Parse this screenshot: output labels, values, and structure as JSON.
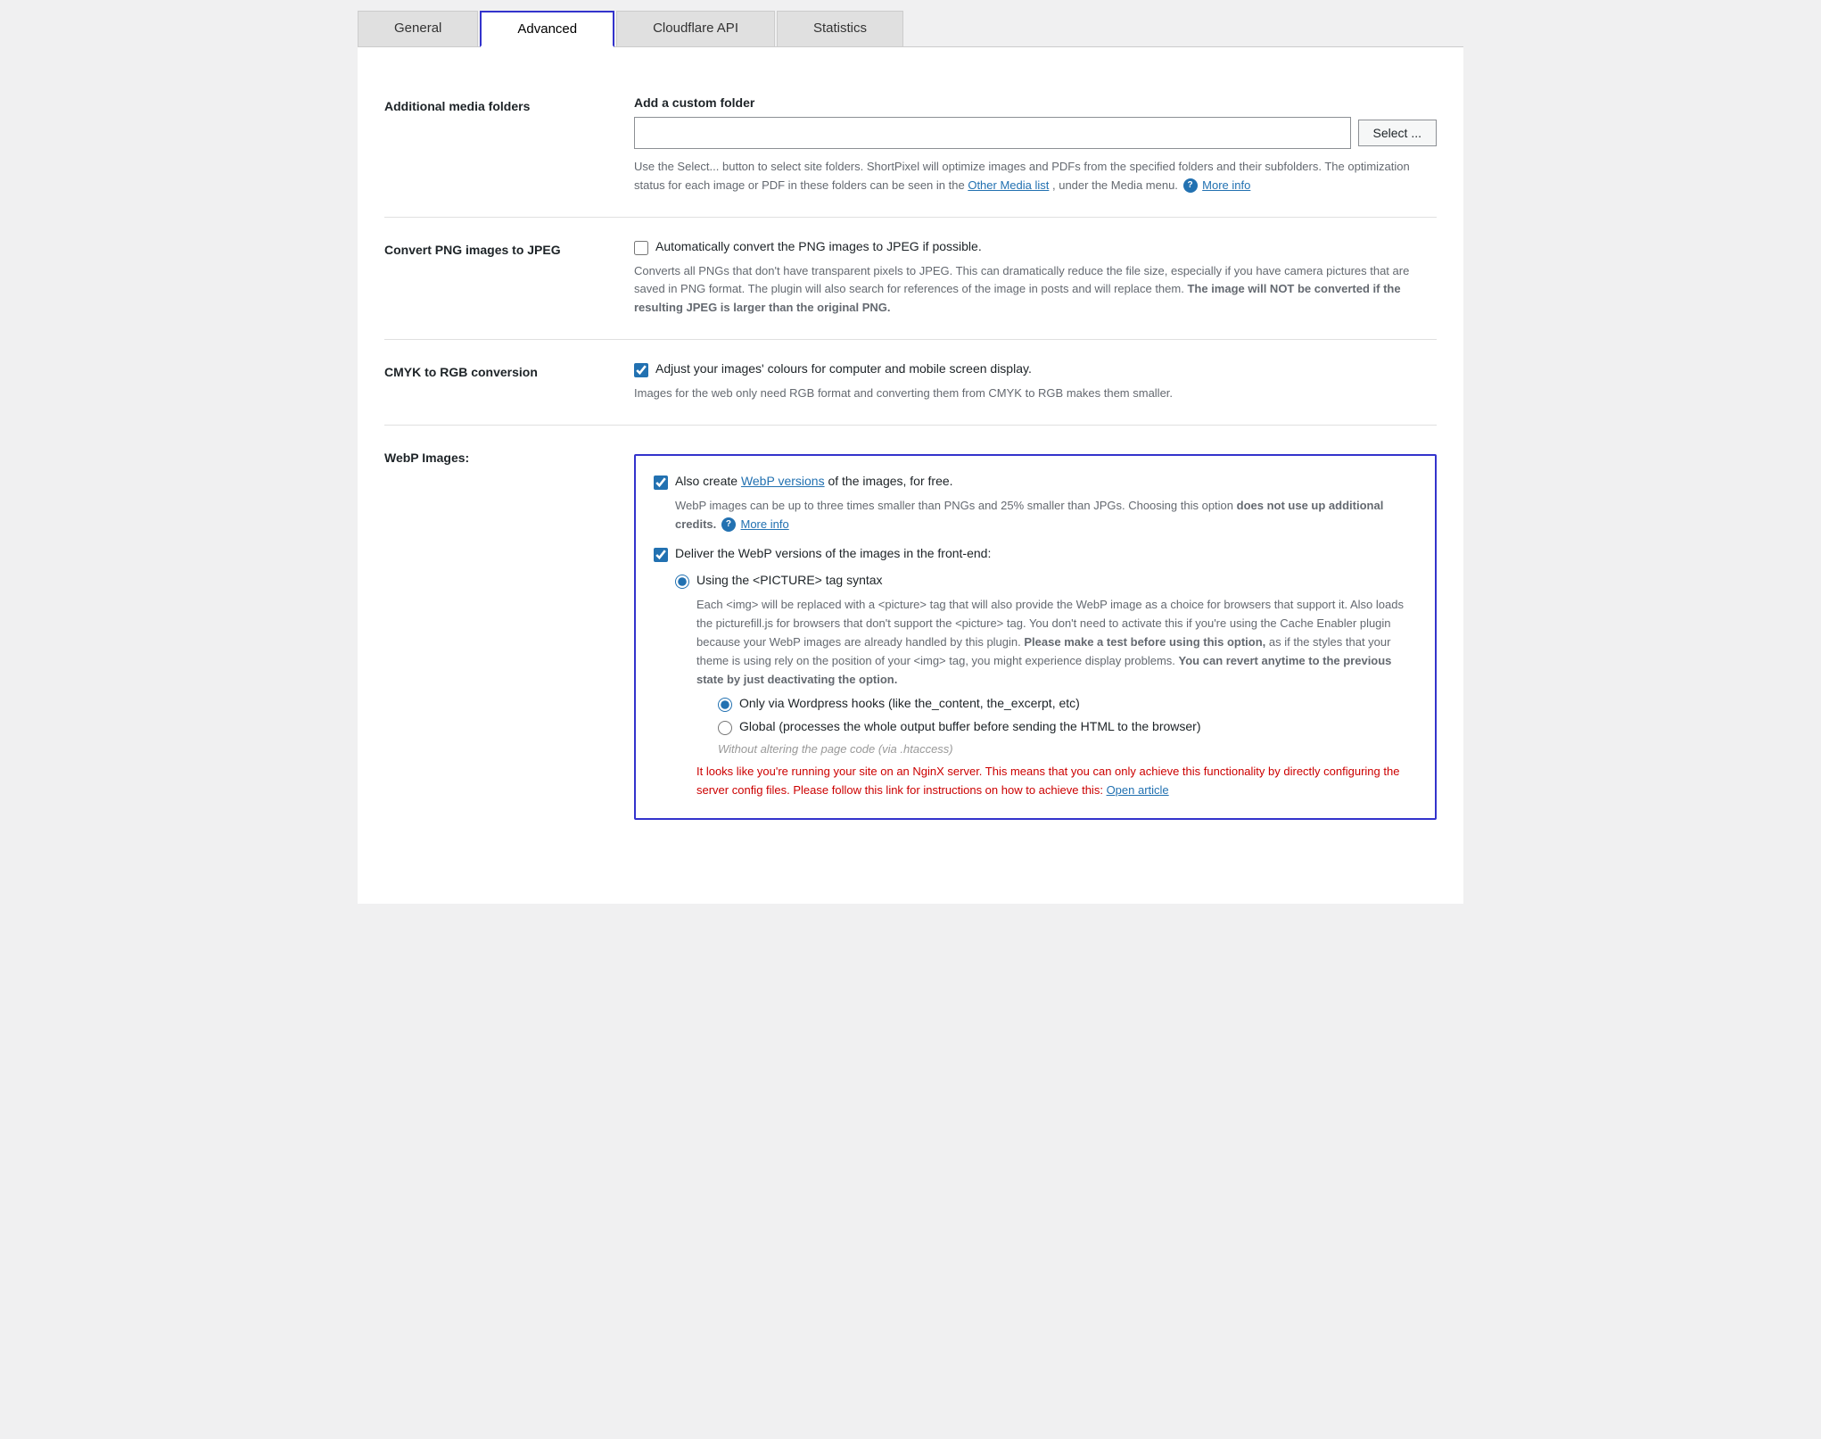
{
  "tabs": [
    {
      "id": "general",
      "label": "General",
      "active": false
    },
    {
      "id": "advanced",
      "label": "Advanced",
      "active": true
    },
    {
      "id": "cloudflare",
      "label": "Cloudflare API",
      "active": false
    },
    {
      "id": "statistics",
      "label": "Statistics",
      "active": false
    }
  ],
  "sections": {
    "additional_media": {
      "label": "Additional media folders",
      "sub_label": "Add a custom folder",
      "select_btn": "Select ...",
      "desc": "Use the Select... button to select site folders. ShortPixel will optimize images and PDFs from the specified folders and their subfolders. The optimization status for each image or PDF in these folders can be seen in the",
      "other_media_link": "Other Media list",
      "desc2": ", under the Media menu.",
      "more_info_link": "More info"
    },
    "convert_png": {
      "label": "Convert PNG images to JPEG",
      "checkbox_label": "Automatically convert the PNG images to JPEG if possible.",
      "desc": "Converts all PNGs that don't have transparent pixels to JPEG. This can dramatically reduce the file size, especially if you have camera pictures that are saved in PNG format. The plugin will also search for references of the image in posts and will replace them.",
      "desc_bold": "The image will NOT be converted if the resulting JPEG is larger than the original PNG.",
      "checked": false
    },
    "cmyk": {
      "label": "CMYK to RGB conversion",
      "checkbox_label": "Adjust your images' colours for computer and mobile screen display.",
      "desc": "Images for the web only need RGB format and converting them from CMYK to RGB makes them smaller.",
      "checked": true
    },
    "webp": {
      "label": "WebP Images:",
      "create_checkbox_label": "Also create",
      "webp_versions_link": "WebP versions",
      "create_checkbox_label2": "of the images, for free.",
      "create_checked": true,
      "webp_desc": "WebP images can be up to three times smaller than PNGs and 25% smaller than JPGs. Choosing this option",
      "webp_desc_bold": "does not use up additional credits.",
      "more_info_link": "More info",
      "deliver_checkbox_label": "Deliver the WebP versions of the images in the front-end:",
      "deliver_checked": true,
      "radio_options": [
        {
          "id": "picture",
          "label": "Using the <PICTURE> tag syntax",
          "selected": true
        },
        {
          "id": "hooks",
          "label": "Only via Wordpress hooks (like the_content, the_excerpt, etc)",
          "selected": true
        },
        {
          "id": "global",
          "label": "Global (processes the whole output buffer before sending the HTML to the browser)",
          "selected": false
        }
      ],
      "picture_desc": "Each <img> will be replaced with a <picture> tag that will also provide the WebP image as a choice for browsers that support it. Also loads the picturefill.js for browsers that don't support the <picture> tag. You don't need to activate this if you're using the Cache Enabler plugin because your WebP images are already handled by this plugin.",
      "picture_desc_bold": "Please make a test before using this option,",
      "picture_desc2": "as if the styles that your theme is using rely on the position of your <img> tag, you might experience display problems.",
      "picture_desc_bold2": "You can revert anytime to the previous state by just deactivating the option.",
      "htaccess_note": "Without altering the page code (via .htaccess)",
      "nginx_warning": "It looks like you're running your site on an NginX server. This means that you can only achieve this functionality by directly configuring the server config files. Please follow this link for instructions on how to achieve this:",
      "open_article_link": "Open article"
    }
  }
}
